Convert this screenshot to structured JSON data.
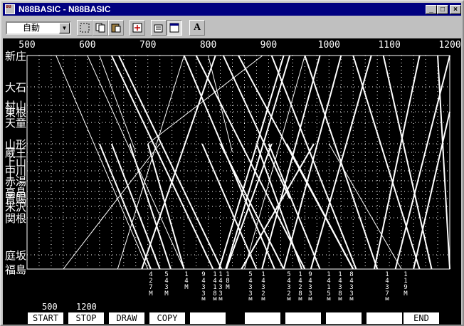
{
  "window": {
    "title": "N88BASIC - N88BASIC",
    "app_icon_label": "88",
    "controls": {
      "minimize": "_",
      "maximize": "□",
      "close": "×"
    }
  },
  "toolbar": {
    "combo_value": "自動",
    "buttons": [
      "select-icon",
      "copy-icon",
      "paste-icon",
      "fullscreen-icon",
      "properties-icon",
      "window-icon",
      "font-icon"
    ],
    "font_button_label": "A"
  },
  "chart_data": {
    "type": "line",
    "title": "",
    "x_axis": {
      "range": [
        500,
        1200
      ],
      "ticks": [
        500,
        600,
        700,
        800,
        900,
        1000,
        1100,
        1200
      ]
    },
    "stations": [
      "新庄",
      "大石",
      "村山",
      "東根",
      "天童",
      "山形",
      "蔵王",
      "上山",
      "中川",
      "赤湯",
      "高畠",
      "置賜",
      "米沢",
      "関根",
      "庭坂",
      "福島"
    ],
    "train_numbers": [
      "427M",
      "543M",
      "14M",
      "9433M",
      "1418M",
      "1433M",
      "18M",
      "5433M",
      "1432M",
      "5432M",
      "1428M",
      "9433M",
      "1415M",
      "1438M",
      "8433M",
      "1437M",
      "119M"
    ]
  },
  "screen": {
    "start_value": "500",
    "stop_value": "1200"
  },
  "function_keys": [
    "START",
    "STOP",
    "DRAW",
    "COPY",
    "",
    "",
    "",
    "",
    "",
    "END"
  ]
}
